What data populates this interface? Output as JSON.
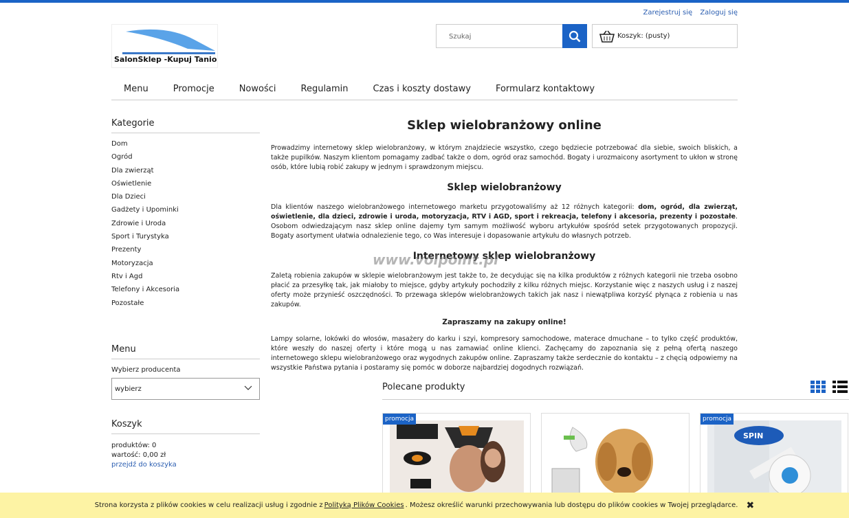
{
  "top": {
    "register": "Zarejestruj się",
    "login": "Zaloguj się"
  },
  "logo": {
    "text": "SalonSklep -Kupuj Tanio"
  },
  "search": {
    "placeholder": "Szukaj"
  },
  "cart_widget": {
    "label": "Koszyk: (pusty)"
  },
  "nav": [
    "Menu",
    "Promocje",
    "Nowości",
    "Regulamin",
    "Czas i koszty dostawy",
    "Formularz kontaktowy"
  ],
  "sidebar": {
    "categories_title": "Kategorie",
    "categories": [
      "Dom",
      "Ogród",
      "Dla zwierząt",
      "Oświetlenie",
      "Dla Dzieci",
      "Gadżety i Upominki",
      "Zdrowie i Uroda",
      "Sport i Turystyka",
      "Prezenty",
      "Motoryzacja",
      "Rtv i Agd",
      "Telefony i Akcesoria",
      "Pozostałe"
    ],
    "menu_title": "Menu",
    "producer_label": "Wybierz producenta",
    "producer_value": "wybierz",
    "cart_title": "Koszyk",
    "cart_products": "produktów: 0",
    "cart_value": "wartość: 0,00 zł",
    "cart_link": "przejdź do koszyka"
  },
  "main": {
    "title": "Sklep wielobranżowy online",
    "p1": "Prowadzimy internetowy sklep wielobranżowy, w którym znajdziecie wszystko, czego będziecie potrzebować dla siebie, swoich bliskich, a także pupilków. Naszym klientom pomagamy zadbać także o dom, ogród oraz samochód. Bogaty i urozmaicony asortyment to ukłon w stronę osób, które lubią robić zakupy w jednym i sprawdzonym miejscu.",
    "h2a": "Sklep wielobranżowy",
    "p2a": "Dla klientów naszego wielobranżowego internetowego marketu przygotowaliśmy aż 12 różnych kategorii: ",
    "p2b": "dom, ogród, dla zwierząt, oświetlenie, dla dzieci, zdrowie i uroda, motoryzacja, RTV i AGD, sport i rekreacja, telefony i akcesoria, prezenty i pozostałe",
    "p2c": ". Osobom odwiedzającym nasz sklep online dajemy tym samym możliwość wyboru artykułów spośród setek przygotowanych propozycji. Bogaty asortyment ułatwia odnalezienie tego, co Was interesuje i dopasowanie artykułu do własnych potrzeb.",
    "h2b": "Internetowy sklep wielobranżowy",
    "p3": "Zaletą robienia zakupów w sklepie wielobranżowym jest także to, że decydując się na kilka produktów z różnych kategorii nie trzeba osobno płacić za przesyłkę tak, jak miałoby to miejsce, gdyby artykuły pochodziły z kilku różnych miejsc. Korzystanie więc z naszych usług i z naszej oferty może przynieść oszczędności. To przewaga sklepów wielobranżowych takich jak nasz i niewątpliwa korzyść płynąca z robienia u nas zakupów.",
    "center": "Zapraszamy na zakupy online!",
    "p4": "Lampy solarne, lokówki do włosów, masażery do karku i szyi, kompresory samochodowe, materace dmuchane – to tylko część produktów, które weszły do naszej oferty i które mogą u nas zamawiać online klienci. Zachęcamy do zapoznania się z pełną ofertą naszego internetowego sklepu wielobranżowego oraz wygodnych zakupów online. Zapraszamy także serdecznie do kontaktu – z chęcią odpowiemy na wszystkie Państwa pytania i postaramy się pomóc w doborze najbardziej dogodnych rozwiązań."
  },
  "watermark": "www.volpoint.pl",
  "featured": {
    "title": "Polecane produkty",
    "promo_label": "promocja"
  },
  "cookie": {
    "text1": "Strona korzysta z plików cookies w celu realizacji usług i zgodnie z",
    "link": "Polityką Plików Cookies",
    "text2": ". Możesz określić warunki przechowywania lub dostępu do plików cookies w Twojej przeglądarce."
  },
  "colors": {
    "accent": "#1b63c6",
    "cookie_bg": "#fdf3a4"
  }
}
